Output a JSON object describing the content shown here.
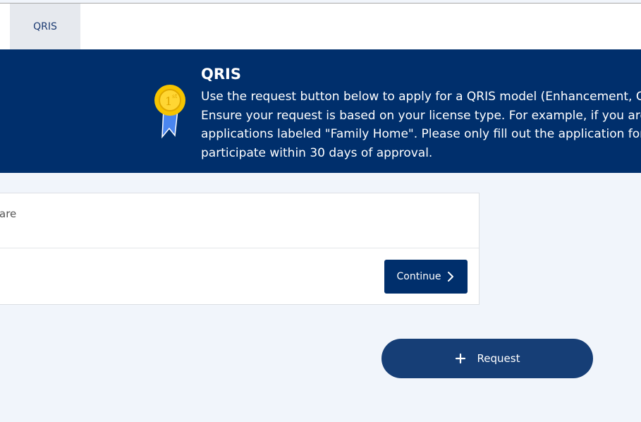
{
  "tabs": {
    "active_label": "QRIS"
  },
  "banner": {
    "title": "QRIS",
    "lines": [
      "Use the request button below to apply for a QRIS model (Enhancement, Guided",
      "Ensure your request is based on your license type. For example, if you are a Family",
      "applications labeled \"Family Home\". Please only fill out the application for the m",
      "participate within 30 days of approval."
    ],
    "icon": "award-ribbon-icon"
  },
  "card": {
    "partial_text": "are",
    "continue_label": "Continue",
    "continue_icon": "chevron-right-icon"
  },
  "request": {
    "label": "Request",
    "icon": "plus-icon"
  },
  "colors": {
    "navy": "#002f6c",
    "request_button": "#163e76",
    "page_background": "#f1f5fb",
    "medal_gold": "#f6c400",
    "ribbon_blue": "#4a86f0"
  }
}
